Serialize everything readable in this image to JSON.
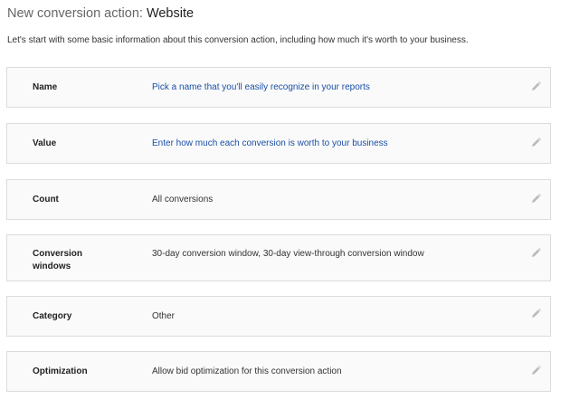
{
  "header": {
    "title_prefix": "New conversion action: ",
    "title_type": "Website"
  },
  "intro": "Let's start with some basic information about this conversion action, including how much it's worth to your business.",
  "icons": {
    "edit": "pencil-icon",
    "icon_color": "#bbbbbb"
  },
  "colors": {
    "placeholder_link": "#1a4fa8",
    "card_background": "#fafafa",
    "card_border": "#dcdcdc"
  },
  "settings": [
    {
      "label": "Name",
      "value": "Pick a name that you'll easily recognize in your reports",
      "placeholder": true
    },
    {
      "label": "Value",
      "value": "Enter how much each conversion is worth to your business",
      "placeholder": true
    },
    {
      "label": "Count",
      "value": "All conversions",
      "placeholder": false
    },
    {
      "label": "Conversion windows",
      "value": "30-day conversion window, 30-day view-through conversion window",
      "placeholder": false
    },
    {
      "label": "Category",
      "value": "Other",
      "placeholder": false
    },
    {
      "label": "Optimization",
      "value": "Allow bid optimization for this conversion action",
      "placeholder": false
    }
  ]
}
